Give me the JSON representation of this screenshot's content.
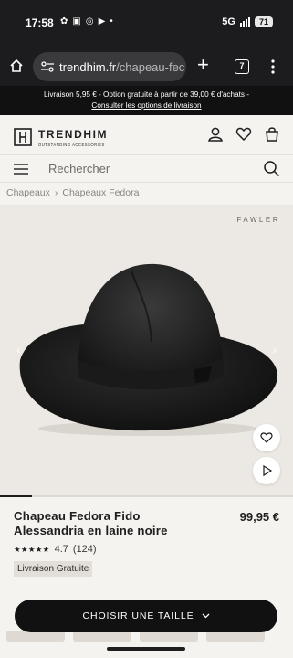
{
  "status": {
    "time": "17:58",
    "network": "5G",
    "battery": "71"
  },
  "browser": {
    "url_host": "trendhim.fr",
    "url_path": "/chapeau-fec",
    "tab_count": "7"
  },
  "promo": {
    "text": "Livraison 5,95 € - Option gratuite à partir de 39,00 € d'achats -",
    "link": "Consulter les options de livraison"
  },
  "header": {
    "brand": "TRENDHIM",
    "tagline": "OUTSTANDING ACCESSORIES"
  },
  "search": {
    "placeholder": "Rechercher"
  },
  "breadcrumb": {
    "items": [
      "Chapeaux",
      "Chapeaux Fedora"
    ],
    "separator": "›"
  },
  "gallery": {
    "brand_watermark": "FAWLER",
    "progress": 0.11
  },
  "product": {
    "title": "Chapeau Fedora Fido Alessandria en laine noire",
    "price": "99,95 €",
    "rating": "4.7",
    "review_count": "(124)",
    "badge": "Livraison Gratuite"
  },
  "cta": {
    "label": "CHOISIR UNE TAILLE"
  },
  "colors": {
    "accent": "#111111",
    "page_bg": "#f5f3ef",
    "image_bg": "#ece9e4"
  }
}
